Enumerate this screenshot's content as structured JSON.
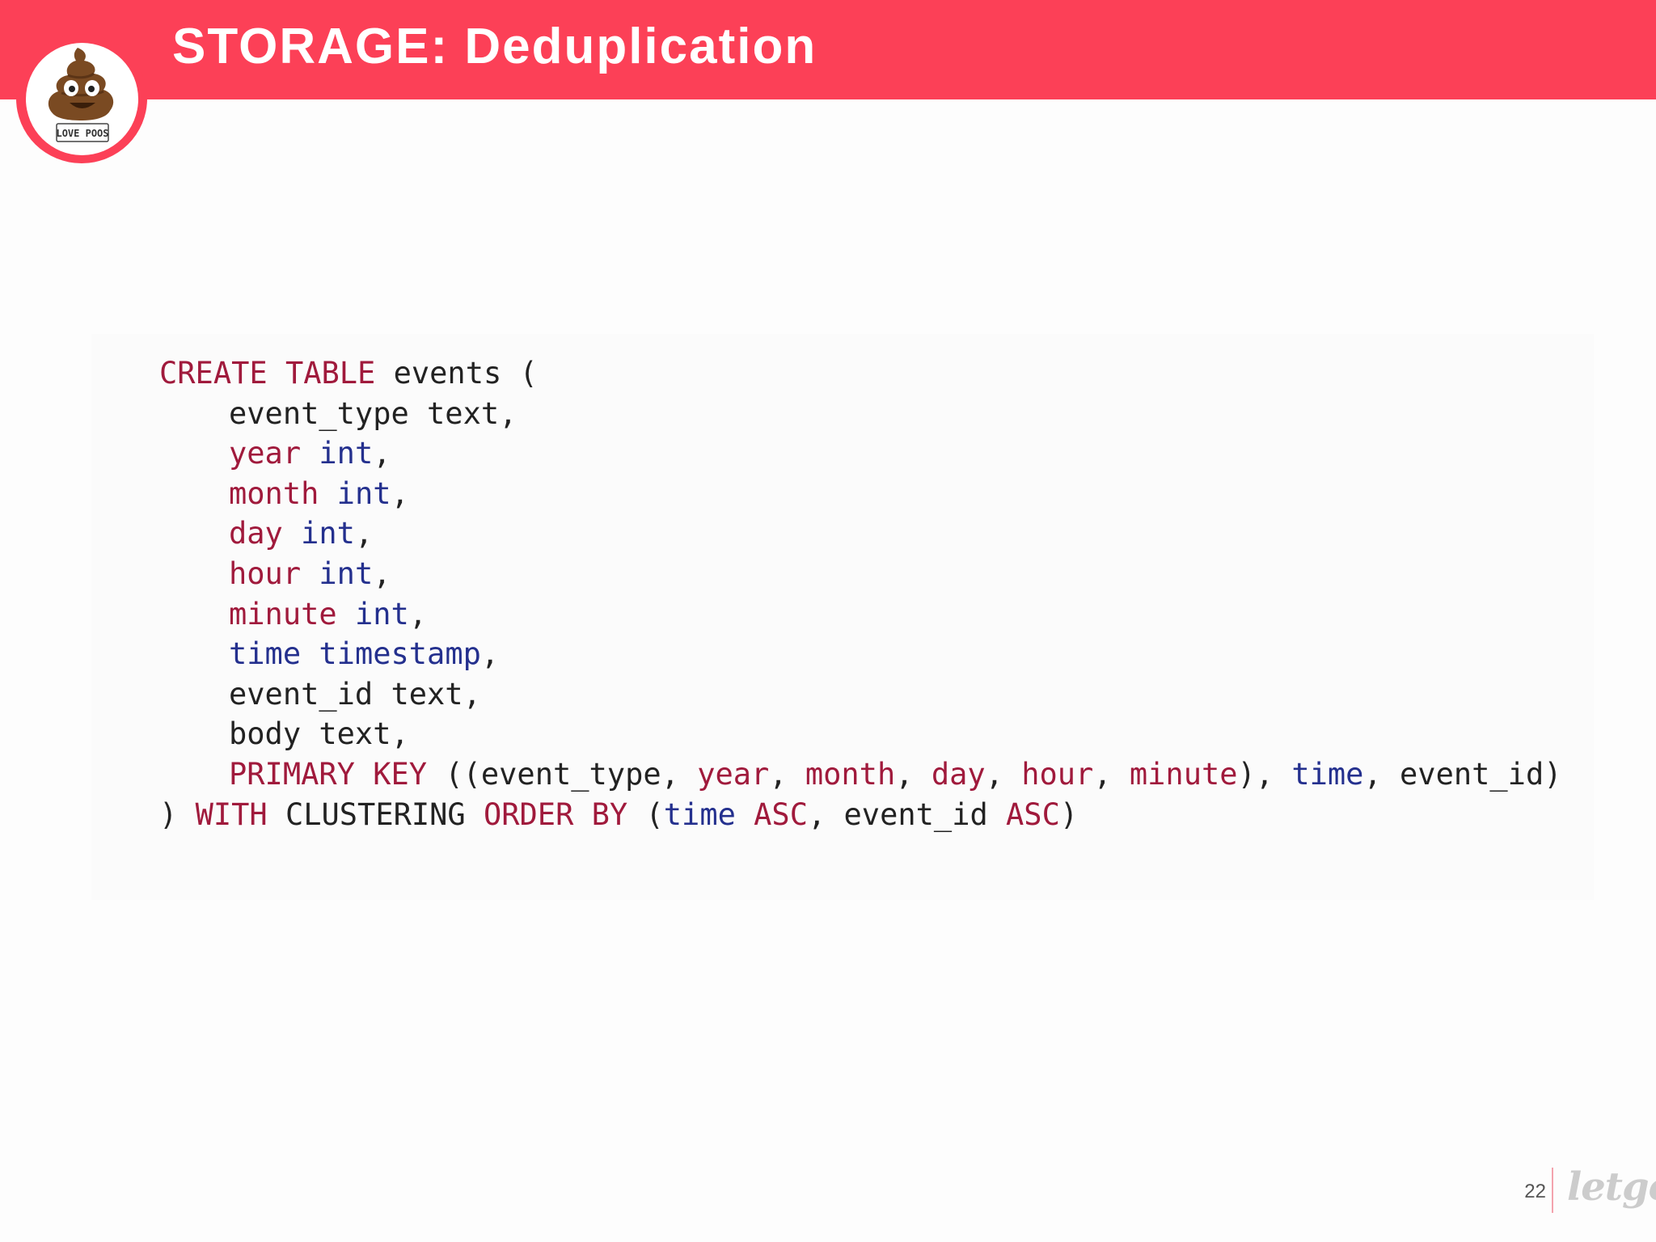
{
  "slide": {
    "title": "STORAGE: Deduplication",
    "page_number": "22",
    "brand": "letgo",
    "logo_text": "LOVE POOS"
  },
  "code": {
    "l1": {
      "t1": "CREATE",
      "t2": " ",
      "t3": "TABLE",
      "t4": " events ("
    },
    "l2": {
      "t1": "event_type text,"
    },
    "l3": {
      "t1": "year",
      "t2": " ",
      "t3": "int",
      "t4": ","
    },
    "l4": {
      "t1": "month",
      "t2": " ",
      "t3": "int",
      "t4": ","
    },
    "l5": {
      "t1": "day",
      "t2": " ",
      "t3": "int",
      "t4": ","
    },
    "l6": {
      "t1": "hour",
      "t2": " ",
      "t3": "int",
      "t4": ","
    },
    "l7": {
      "t1": "minute",
      "t2": " ",
      "t3": "int",
      "t4": ","
    },
    "l8": {
      "t1": "time",
      "t2": " ",
      "t3": "timestamp",
      "t4": ","
    },
    "l9": {
      "t1": "event_id text,"
    },
    "l10": {
      "t1": "body text,"
    },
    "l11": {
      "t1": "PRIMARY KEY",
      "t2": " ((event_type, ",
      "t3": "year",
      "t4": ", ",
      "t5": "month",
      "t6": ", ",
      "t7": "day",
      "t8": ", ",
      "t9": "hour",
      "t10": ", ",
      "t11": "minute",
      "t12": "), ",
      "t13": "time",
      "t14": ", event_id)"
    },
    "l12": {
      "t1": ") ",
      "t2": "WITH",
      "t3": " CLUSTERING ",
      "t4": "ORDER BY",
      "t5": " (",
      "t6": "time",
      "t7": " ",
      "t8": "ASC",
      "t9": ", event_id ",
      "t10": "ASC",
      "t11": ")"
    }
  },
  "colors": {
    "header": "#fc4057",
    "keyword_red": "#a01a3c",
    "keyword_blue": "#24308e",
    "code_text": "#222222"
  }
}
